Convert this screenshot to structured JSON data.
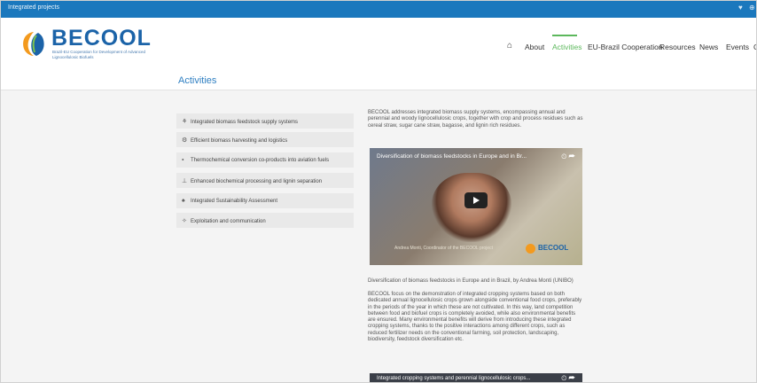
{
  "topbar": {
    "title": "Integrated projects",
    "social": [
      "♥",
      "⊕"
    ]
  },
  "header": {
    "brand": "BECOOL",
    "tagline": "Brazil-EU Cooperation for Development of Advanced Lignocellulosic Biofuels"
  },
  "nav": {
    "home_icon": "home-icon",
    "items": [
      "About",
      "Activities",
      "EU-Brazil Cooperation",
      "Resources",
      "News",
      "Events",
      "C"
    ],
    "active": "Activities"
  },
  "page": {
    "title": "Activities"
  },
  "menu": {
    "items": [
      {
        "icon": "⚘",
        "label": "Integrated biomass feedstock supply systems"
      },
      {
        "icon": "⚙",
        "label": "Efficient biomass harvesting and logistics"
      },
      {
        "icon": "⬩",
        "label": "Thermochemical conversion co-products into aviation fuels"
      },
      {
        "icon": "⊥",
        "label": "Enhanced biochemical processing and lignin separation"
      },
      {
        "icon": "♠",
        "label": "Integrated Sustainability Assessment"
      },
      {
        "icon": "✧",
        "label": "Exploitation and communication"
      }
    ]
  },
  "content": {
    "intro": "BECOOL addresses integrated biomass supply systems, encompassing annual and perennial and woody lignocellulosic crops, together with crop and process residues such as cereal straw, sugar cane straw, bagasse, and lignin rich residues.",
    "video1_title": "Diversification of biomass feedstocks in Europe and in Br...",
    "video1_caption": "Andrea Monti, Coordinator of the BECOOL project",
    "video1_brand": "BECOOL",
    "video_caption": "Diversification of biomass feedstocks in Europe and in Brazil, by Andrea Monti (UNIBO)",
    "body": "BECOOL focus on the demonstration of integrated cropping systems based on both dedicated annual lignocellulosic crops grown alongside conventional food crops, preferably in the periods of the year in which these are not cultivated. In this way, land competition between food and biofuel crops is completely avoided, while also environmental benefits are ensured. Many environmental benefits will derive from introducing these integrated cropping systems, thanks to the positive interactions among different crops, such as reduced fertilizer needs on the conventional farming, soil protection, landscaping, biodiversity, feedstock diversification etc.",
    "video2_title": "Integrated cropping systems and perennial lignocellulosic crops..."
  }
}
